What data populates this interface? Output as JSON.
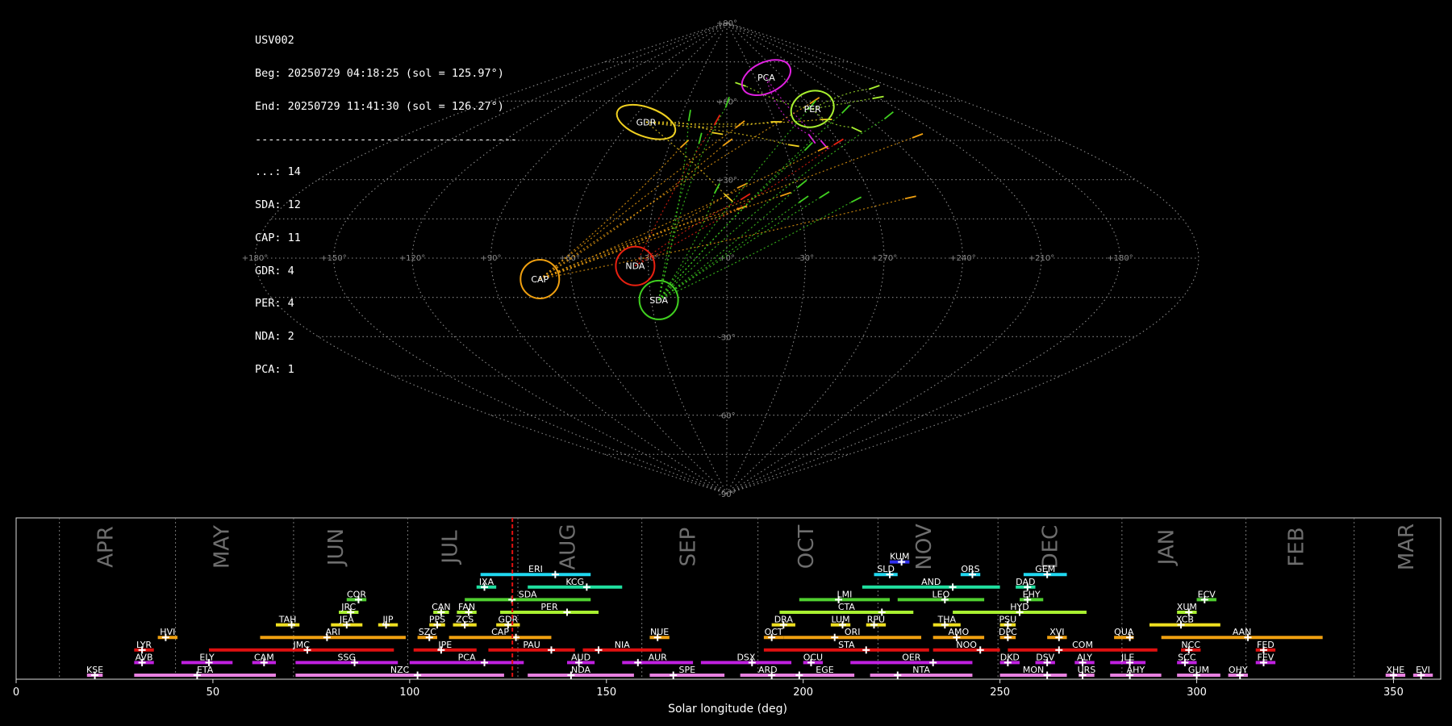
{
  "info": {
    "lines": [
      "USV002",
      "Beg: 20250729 04:18:25 (sol = 125.97°)",
      "End: 20250729 11:41:30 (sol = 126.27°)",
      "----------------------------------------",
      "...: 14",
      "SDA: 12",
      "CAP: 11",
      "GDR: 4",
      "PER: 4",
      "NDA: 2",
      "PCA: 1"
    ]
  },
  "chart_data": [
    {
      "type": "scatter",
      "projection": "sinusoidal",
      "lon_ticks": [
        "+180°",
        "+150°",
        "+120°",
        "+90°",
        "+60°",
        "+30°",
        "+0°",
        "-30°",
        "+270°",
        "+240°",
        "+210°",
        "+180°"
      ],
      "lat_ticks": [
        "+90°",
        "+60°",
        "+30°",
        "-30°",
        "-60°",
        "-90°"
      ],
      "grid": true,
      "radiants": [
        {
          "name": "PCA",
          "lon": 42,
          "lat": 69,
          "color": "#e020e0"
        },
        {
          "name": "PER",
          "lon": 60,
          "lat": 57,
          "color": "#a8f030"
        },
        {
          "name": "GDR",
          "lon": -50,
          "lat": 52,
          "color": "#f0d020"
        },
        {
          "name": "NDA",
          "lon": -35,
          "lat": -3,
          "color": "#e82010"
        },
        {
          "name": "CAP",
          "lon": -72,
          "lat": -8,
          "color": "#f0a010"
        },
        {
          "name": "SDA",
          "lon": -27,
          "lat": -16,
          "color": "#40d020"
        }
      ]
    },
    {
      "type": "bar",
      "xlabel": "Solar longitude (deg)",
      "xlim": [
        0,
        362
      ],
      "x_ticks": [
        0,
        50,
        100,
        150,
        200,
        250,
        300,
        350
      ],
      "current_sol": 126.1,
      "months": [
        {
          "name": "APR",
          "start": 11,
          "label_at": 24.5
        },
        {
          "name": "MAY",
          "start": 40.5,
          "label_at": 54
        },
        {
          "name": "JUN",
          "start": 70.5,
          "label_at": 83
        },
        {
          "name": "JUL",
          "start": 99.5,
          "label_at": 112
        },
        {
          "name": "AUG",
          "start": 127.5,
          "label_at": 142
        },
        {
          "name": "SEP",
          "start": 159,
          "label_at": 172.5
        },
        {
          "name": "OCT",
          "start": 188.5,
          "label_at": 202.5
        },
        {
          "name": "NOV",
          "start": 219,
          "label_at": 232.5
        },
        {
          "name": "DEC",
          "start": 249.5,
          "label_at": 264.5
        },
        {
          "name": "JAN",
          "start": 281,
          "label_at": 294
        },
        {
          "name": "FEB",
          "start": 312.5,
          "label_at": 327
        },
        {
          "name": "MAR",
          "start": 340,
          "label_at": 355
        }
      ],
      "showers": [
        {
          "name": "KUM",
          "start": 222,
          "end": 227,
          "peak": 225,
          "row": 10,
          "color": "#3030f0"
        },
        {
          "name": "ERI",
          "start": 118,
          "end": 146,
          "peak": 137,
          "row": 9,
          "color": "#20d8f0"
        },
        {
          "name": "SLD",
          "start": 218,
          "end": 224,
          "peak": 222,
          "row": 9,
          "color": "#20d8f0"
        },
        {
          "name": "ORS",
          "start": 240,
          "end": 245,
          "peak": 243,
          "row": 9,
          "color": "#20d8f0"
        },
        {
          "name": "GEM",
          "start": 256,
          "end": 267,
          "peak": 262,
          "row": 9,
          "color": "#20d8f0"
        },
        {
          "name": "IXA",
          "start": 117,
          "end": 122,
          "peak": 119,
          "row": 8,
          "color": "#20e0a0"
        },
        {
          "name": "KCG",
          "start": 130,
          "end": 154,
          "peak": 145,
          "row": 8,
          "color": "#20e0a0"
        },
        {
          "name": "AND",
          "start": 215,
          "end": 250,
          "peak": 238,
          "row": 8,
          "color": "#20e0a0"
        },
        {
          "name": "DAD",
          "start": 254,
          "end": 259,
          "peak": 257,
          "row": 8,
          "color": "#20e0a0"
        },
        {
          "name": "COR",
          "start": 84,
          "end": 89,
          "peak": 87,
          "row": 7,
          "color": "#50d030"
        },
        {
          "name": "SDA",
          "start": 114,
          "end": 146,
          "peak": 126,
          "row": 7,
          "color": "#50d030"
        },
        {
          "name": "LMI",
          "start": 199,
          "end": 222,
          "peak": 209,
          "row": 7,
          "color": "#50d030"
        },
        {
          "name": "LEO",
          "start": 224,
          "end": 246,
          "peak": 236,
          "row": 7,
          "color": "#50d030"
        },
        {
          "name": "EHY",
          "start": 255,
          "end": 261,
          "peak": 257,
          "row": 7,
          "color": "#50d030"
        },
        {
          "name": "ECV",
          "start": 300,
          "end": 305,
          "peak": 302,
          "row": 7,
          "color": "#50d030"
        },
        {
          "name": "JRC",
          "start": 82,
          "end": 87,
          "peak": 85,
          "row": 6,
          "color": "#a8f030"
        },
        {
          "name": "CAN",
          "start": 106,
          "end": 110,
          "peak": 108,
          "row": 6,
          "color": "#a8f030"
        },
        {
          "name": "FAN",
          "start": 112,
          "end": 117,
          "peak": 115,
          "row": 6,
          "color": "#a8f030"
        },
        {
          "name": "PER",
          "start": 123,
          "end": 148,
          "peak": 140,
          "row": 6,
          "color": "#a8f030"
        },
        {
          "name": "CTA",
          "start": 194,
          "end": 228,
          "peak": 220,
          "row": 6,
          "color": "#a8f030"
        },
        {
          "name": "HYD",
          "start": 238,
          "end": 272,
          "peak": 255,
          "row": 6,
          "color": "#a8f030"
        },
        {
          "name": "XUM",
          "start": 295,
          "end": 300,
          "peak": 298,
          "row": 6,
          "color": "#a8f030"
        },
        {
          "name": "TAH",
          "start": 66,
          "end": 72,
          "peak": 70,
          "row": 5,
          "color": "#f0e020"
        },
        {
          "name": "JEA",
          "start": 80,
          "end": 88,
          "peak": 84,
          "row": 5,
          "color": "#f0e020"
        },
        {
          "name": "JIP",
          "start": 92,
          "end": 97,
          "peak": 94,
          "row": 5,
          "color": "#f0e020"
        },
        {
          "name": "PPS",
          "start": 105,
          "end": 109,
          "peak": 107,
          "row": 5,
          "color": "#f0e020"
        },
        {
          "name": "ZCS",
          "start": 111,
          "end": 117,
          "peak": 114,
          "row": 5,
          "color": "#f0e020"
        },
        {
          "name": "GDR",
          "start": 122,
          "end": 128,
          "peak": 125,
          "row": 5,
          "color": "#f0e020"
        },
        {
          "name": "DRA",
          "start": 192,
          "end": 198,
          "peak": 195,
          "row": 5,
          "color": "#f0e020"
        },
        {
          "name": "LUM",
          "start": 207,
          "end": 212,
          "peak": 210,
          "row": 5,
          "color": "#f0e020"
        },
        {
          "name": "RPU",
          "start": 216,
          "end": 221,
          "peak": 218,
          "row": 5,
          "color": "#f0e020"
        },
        {
          "name": "THA",
          "start": 233,
          "end": 240,
          "peak": 236,
          "row": 5,
          "color": "#f0e020"
        },
        {
          "name": "PSU",
          "start": 250,
          "end": 254,
          "peak": 252,
          "row": 5,
          "color": "#f0e020"
        },
        {
          "name": "XCB",
          "start": 288,
          "end": 306,
          "peak": 296,
          "row": 5,
          "color": "#f0e020"
        },
        {
          "name": "HVI",
          "start": 36,
          "end": 41,
          "peak": 38,
          "row": 4,
          "color": "#f0a010"
        },
        {
          "name": "ARI",
          "start": 62,
          "end": 99,
          "peak": 79,
          "row": 4,
          "color": "#f0a010"
        },
        {
          "name": "SZC",
          "start": 102,
          "end": 107,
          "peak": 105,
          "row": 4,
          "color": "#f0a010"
        },
        {
          "name": "CAP",
          "start": 110,
          "end": 136,
          "peak": 127,
          "row": 4,
          "color": "#f0a010"
        },
        {
          "name": "NUE",
          "start": 161,
          "end": 166,
          "peak": 163,
          "row": 4,
          "color": "#f0a010"
        },
        {
          "name": "OCT",
          "start": 190,
          "end": 195,
          "peak": 192,
          "row": 4,
          "color": "#f0a010"
        },
        {
          "name": "ORI",
          "start": 195,
          "end": 230,
          "peak": 208,
          "row": 4,
          "color": "#f0a010"
        },
        {
          "name": "AMO",
          "start": 233,
          "end": 246,
          "peak": 239,
          "row": 4,
          "color": "#f0a010"
        },
        {
          "name": "DPC",
          "start": 250,
          "end": 254,
          "peak": 252,
          "row": 4,
          "color": "#f0a010"
        },
        {
          "name": "XVI",
          "start": 262,
          "end": 267,
          "peak": 265,
          "row": 4,
          "color": "#f0a010"
        },
        {
          "name": "QUA",
          "start": 279,
          "end": 284,
          "peak": 283,
          "row": 4,
          "color": "#f0a010"
        },
        {
          "name": "AAN",
          "start": 291,
          "end": 332,
          "peak": 313,
          "row": 4,
          "color": "#f0a010"
        },
        {
          "name": "LYR",
          "start": 30,
          "end": 35,
          "peak": 32,
          "row": 3,
          "color": "#e01010"
        },
        {
          "name": "JMC",
          "start": 49,
          "end": 96,
          "peak": 74,
          "row": 3,
          "color": "#e01010"
        },
        {
          "name": "JPE",
          "start": 101,
          "end": 117,
          "peak": 108,
          "row": 3,
          "color": "#e01010"
        },
        {
          "name": "PAU",
          "start": 120,
          "end": 142,
          "peak": 136,
          "row": 3,
          "color": "#e01010"
        },
        {
          "name": "NIA",
          "start": 144,
          "end": 164,
          "peak": 148,
          "row": 3,
          "color": "#e01010"
        },
        {
          "name": "STA",
          "start": 190,
          "end": 232,
          "peak": 216,
          "row": 3,
          "color": "#e01010"
        },
        {
          "name": "NOO",
          "start": 233,
          "end": 250,
          "peak": 245,
          "row": 3,
          "color": "#e01010"
        },
        {
          "name": "COM",
          "start": 252,
          "end": 290,
          "peak": 265,
          "row": 3,
          "color": "#e01010"
        },
        {
          "name": "NCC",
          "start": 296,
          "end": 301,
          "peak": 298,
          "row": 3,
          "color": "#e01010"
        },
        {
          "name": "FED",
          "start": 315,
          "end": 320,
          "peak": 317,
          "row": 3,
          "color": "#e01010"
        },
        {
          "name": "AVB",
          "start": 30,
          "end": 35,
          "peak": 32,
          "row": 2,
          "color": "#c020e0"
        },
        {
          "name": "ELY",
          "start": 42,
          "end": 55,
          "peak": 49,
          "row": 2,
          "color": "#c020e0"
        },
        {
          "name": "CAM",
          "start": 60,
          "end": 66,
          "peak": 63,
          "row": 2,
          "color": "#c020e0"
        },
        {
          "name": "SSG",
          "start": 71,
          "end": 97,
          "peak": 86,
          "row": 2,
          "color": "#c020e0"
        },
        {
          "name": "PCA",
          "start": 100,
          "end": 129,
          "peak": 119,
          "row": 2,
          "color": "#c020e0"
        },
        {
          "name": "AUD",
          "start": 140,
          "end": 147,
          "peak": 143,
          "row": 2,
          "color": "#c020e0"
        },
        {
          "name": "AUR",
          "start": 154,
          "end": 172,
          "peak": 158,
          "row": 2,
          "color": "#c020e0"
        },
        {
          "name": "DSX",
          "start": 174,
          "end": 197,
          "peak": 187,
          "row": 2,
          "color": "#c020e0"
        },
        {
          "name": "OCU",
          "start": 200,
          "end": 205,
          "peak": 202,
          "row": 2,
          "color": "#c020e0"
        },
        {
          "name": "OER",
          "start": 212,
          "end": 243,
          "peak": 233,
          "row": 2,
          "color": "#c020e0"
        },
        {
          "name": "DKD",
          "start": 250,
          "end": 255,
          "peak": 252,
          "row": 2,
          "color": "#c020e0"
        },
        {
          "name": "DSV",
          "start": 259,
          "end": 264,
          "peak": 262,
          "row": 2,
          "color": "#c020e0"
        },
        {
          "name": "ALY",
          "start": 269,
          "end": 274,
          "peak": 271,
          "row": 2,
          "color": "#c020e0"
        },
        {
          "name": "JLE",
          "start": 278,
          "end": 287,
          "peak": 283,
          "row": 2,
          "color": "#c020e0"
        },
        {
          "name": "SCC",
          "start": 295,
          "end": 300,
          "peak": 297,
          "row": 2,
          "color": "#c020e0"
        },
        {
          "name": "FEV",
          "start": 315,
          "end": 320,
          "peak": 317,
          "row": 2,
          "color": "#c020e0"
        },
        {
          "name": "KSE",
          "start": 18,
          "end": 22,
          "peak": 20,
          "row": 1,
          "color": "#e880e0"
        },
        {
          "name": "ETA",
          "start": 30,
          "end": 66,
          "peak": 46,
          "row": 1,
          "color": "#e880e0"
        },
        {
          "name": "NZC",
          "start": 71,
          "end": 124,
          "peak": 102,
          "row": 1,
          "color": "#e880e0"
        },
        {
          "name": "NDA",
          "start": 130,
          "end": 157,
          "peak": 141,
          "row": 1,
          "color": "#e880e0"
        },
        {
          "name": "SPE",
          "start": 161,
          "end": 180,
          "peak": 167,
          "row": 1,
          "color": "#e880e0"
        },
        {
          "name": "ARD",
          "start": 184,
          "end": 198,
          "peak": 192,
          "row": 1,
          "color": "#e880e0"
        },
        {
          "name": "EGE",
          "start": 198,
          "end": 213,
          "peak": 199,
          "row": 1,
          "color": "#e880e0"
        },
        {
          "name": "NTA",
          "start": 217,
          "end": 243,
          "peak": 224,
          "row": 1,
          "color": "#e880e0"
        },
        {
          "name": "MON",
          "start": 250,
          "end": 267,
          "peak": 262,
          "row": 1,
          "color": "#e880e0"
        },
        {
          "name": "URS",
          "start": 270,
          "end": 274,
          "peak": 271,
          "row": 1,
          "color": "#e880e0"
        },
        {
          "name": "AHY",
          "start": 278,
          "end": 291,
          "peak": 283,
          "row": 1,
          "color": "#e880e0"
        },
        {
          "name": "GUM",
          "start": 295,
          "end": 306,
          "peak": 300,
          "row": 1,
          "color": "#e880e0"
        },
        {
          "name": "OHY",
          "start": 308,
          "end": 313,
          "peak": 311,
          "row": 1,
          "color": "#e880e0"
        },
        {
          "name": "XHE",
          "start": 348,
          "end": 353,
          "peak": 350,
          "row": 1,
          "color": "#e880e0"
        },
        {
          "name": "EVI",
          "start": 355,
          "end": 360,
          "peak": 357,
          "row": 1,
          "color": "#e880e0"
        }
      ]
    }
  ]
}
